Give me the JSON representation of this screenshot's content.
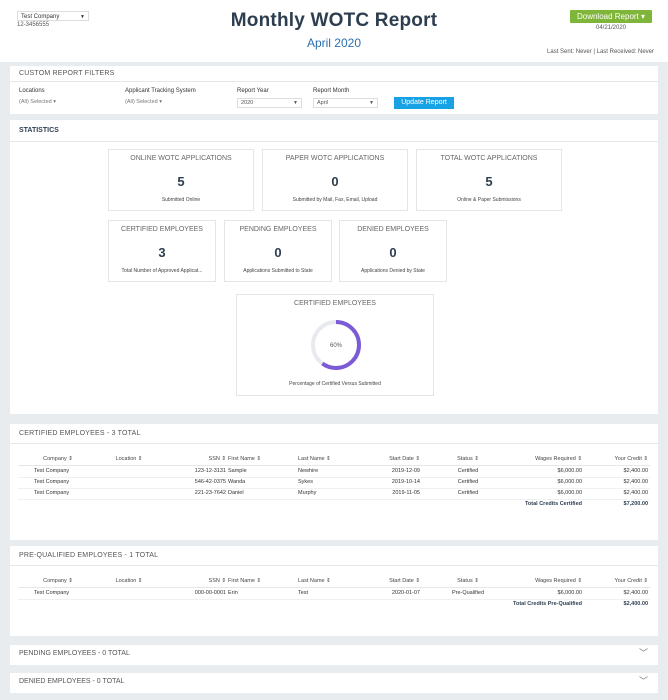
{
  "header": {
    "company": "Test Company",
    "company_id": "12-3456555",
    "title": "Monthly WOTC Report",
    "subtitle": "April 2020",
    "download_label": "Download Report",
    "download_date": "04/21/2020",
    "last_sent": "Last Sent: Never | Last Received: Never"
  },
  "filters": {
    "title": "CUSTOM REPORT FILTERS",
    "locations_label": "Locations",
    "locations_value": "(All) Selected",
    "ats_label": "Applicant Tracking System",
    "ats_value": "(All) Selected",
    "year_label": "Report Year",
    "year_value": "2020",
    "month_label": "Report Month",
    "month_value": "April",
    "update_label": "Update Report"
  },
  "stats": {
    "title": "STATISTICS",
    "cards": [
      {
        "title": "ONLINE WOTC APPLICATIONS",
        "value": "5",
        "caption": "Submitted Online"
      },
      {
        "title": "PAPER WOTC APPLICATIONS",
        "value": "0",
        "caption": "Submitted by Mail, Fax, Email, Upload"
      },
      {
        "title": "TOTAL WOTC APPLICATIONS",
        "value": "5",
        "caption": "Online & Paper Submissions"
      },
      {
        "title": "CERTIFIED EMPLOYEES",
        "value": "3",
        "caption": "Total Number of Approved Applicat..."
      },
      {
        "title": "PENDING EMPLOYEES",
        "value": "0",
        "caption": "Applications Submitted to State"
      },
      {
        "title": "DENIED EMPLOYEES",
        "value": "0",
        "caption": "Applications Denied by State"
      }
    ],
    "donut": {
      "title": "CERTIFIED EMPLOYEES",
      "label": "60%",
      "fraction": 0.6,
      "caption": "Percentage of Certified Versus Submitted",
      "color": "#7b5cd6"
    }
  },
  "certified": {
    "title": "CERTIFIED EMPLOYEES - 3 TOTAL",
    "headers": [
      "Company ⇕",
      "Location ⇕",
      "SSN ⇕",
      "First Name ⇕",
      "Last Name ⇕",
      "Start Date ⇕",
      "Status ⇕",
      "Wages Required ⇕",
      "Your Credit ⇕"
    ],
    "rows": [
      [
        "Test Company",
        "",
        "123-12-3131",
        "Sample",
        "Newhire",
        "2019-12-09",
        "Certified",
        "$6,000.00",
        "$2,400.00"
      ],
      [
        "Test Company",
        "",
        "546-42-0375",
        "Wanda",
        "Sykes",
        "2019-10-14",
        "Certified",
        "$6,000.00",
        "$2,400.00"
      ],
      [
        "Test Company",
        "",
        "221-23-7642",
        "Daniel",
        "Murphy",
        "2019-11-05",
        "Certified",
        "$6,000.00",
        "$2,400.00"
      ]
    ],
    "total_label": "Total Credits Certified",
    "total_value": "$7,200.00"
  },
  "prequalified": {
    "title": "PRE-QUALIFIED EMPLOYEES - 1 TOTAL",
    "headers": [
      "Company ⇕",
      "Location ⇕",
      "SSN ⇕",
      "First Name ⇕",
      "Last Name ⇕",
      "Start Date ⇕",
      "Status ⇕",
      "Wages Required ⇕",
      "Your Credit ⇕"
    ],
    "rows": [
      [
        "Test Company",
        "",
        "000-00-0001",
        "Erin",
        "Test",
        "2020-01-07",
        "Pre-Qualified",
        "$6,000.00",
        "$2,400.00"
      ]
    ],
    "total_label": "Total Credits Pre-Qualified",
    "total_value": "$2,400.00"
  },
  "pending": {
    "title": "PENDING EMPLOYEES - 0 TOTAL"
  },
  "denied": {
    "title": "DENIED EMPLOYEES - 0 TOTAL"
  }
}
